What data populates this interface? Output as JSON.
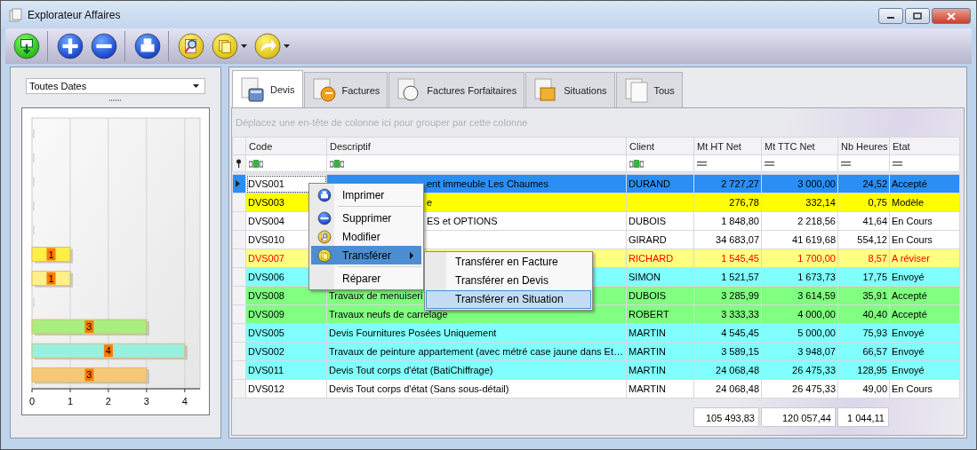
{
  "window": {
    "title": "Explorateur Affaires"
  },
  "toolbar": [
    {
      "kind": "export",
      "dropdown": false,
      "separator_after": true
    },
    {
      "kind": "add",
      "dropdown": false,
      "separator_after": false
    },
    {
      "kind": "remove",
      "dropdown": false,
      "separator_after": true
    },
    {
      "kind": "print",
      "dropdown": false,
      "separator_after": true
    },
    {
      "kind": "search",
      "dropdown": false,
      "separator_after": false
    },
    {
      "kind": "documents",
      "dropdown": true,
      "separator_after": false
    },
    {
      "kind": "forward",
      "dropdown": true,
      "separator_after": false
    }
  ],
  "date_filter": {
    "value": "Toutes Dates"
  },
  "chart_data": {
    "type": "bar",
    "orientation": "horizontal",
    "values": [
      0,
      0,
      0,
      0,
      0,
      1,
      1,
      0,
      3,
      4,
      3
    ],
    "colors": [
      "#dddddd",
      "#dddddd",
      "#dddddd",
      "#dddddd",
      "#dddddd",
      "#ffee44",
      "#fff08a",
      "#dddddd",
      "#a8ee80",
      "#9af0e0",
      "#f5c878"
    ],
    "xlim": [
      0,
      4.4
    ],
    "xticks": [
      0,
      1,
      2,
      3,
      4
    ],
    "grid": true,
    "value_labels": [
      null,
      null,
      null,
      null,
      null,
      "1",
      "1",
      null,
      "3",
      "4",
      "3"
    ]
  },
  "tabs": [
    {
      "label": "Devis",
      "kind": "calculator",
      "selected": true
    },
    {
      "label": "Factures",
      "kind": "euro",
      "selected": false
    },
    {
      "label": "Factures Forfaitaires",
      "kind": "euro-doc",
      "selected": false
    },
    {
      "label": "Situations",
      "kind": "percent",
      "selected": false
    },
    {
      "label": "Tous",
      "kind": "docs",
      "selected": false
    }
  ],
  "group_panel": {
    "placeholder": "Déplacez une en-tête de colonne ici pour grouper par cette colonne"
  },
  "table": {
    "columns": [
      {
        "label": "Code",
        "kind": "text"
      },
      {
        "label": "Descriptif",
        "kind": "text"
      },
      {
        "label": "Client",
        "kind": "text"
      },
      {
        "label": "Mt HT Net",
        "kind": "number"
      },
      {
        "label": "Mt TTC Net",
        "kind": "number"
      },
      {
        "label": "Nb Heures",
        "kind": "number"
      },
      {
        "label": "Etat",
        "kind": "number"
      }
    ],
    "rows": [
      {
        "selected": true,
        "under_menu": true,
        "alert": false,
        "code": "DVS001",
        "descriptif": "ent immeuble Les Chaumes",
        "client": "DURAND",
        "ht": "2 727,27",
        "ttc": "3 000,00",
        "heures": "24,52",
        "etat": "Accepté"
      },
      {
        "selected": false,
        "under_menu": true,
        "alert": false,
        "color": "#ffff00",
        "code": "DVS003",
        "descriptif": "e",
        "ht": "276,78",
        "ttc": "332,14",
        "heures": "0,75",
        "etat": "Modèle"
      },
      {
        "selected": false,
        "under_menu": true,
        "alert": false,
        "color": "#ffffff",
        "code": "DVS004",
        "descriptif": "ES et OPTIONS",
        "client": "DUBOIS",
        "ht": "1 848,80",
        "ttc": "2 218,56",
        "heures": "41,64",
        "etat": "En Cours"
      },
      {
        "selected": false,
        "alert": false,
        "color": "#ffffff",
        "code": "DVS010",
        "client": "GIRARD",
        "ht": "34 683,07",
        "ttc": "41 619,68",
        "heures": "554,12",
        "etat": "En Cours"
      },
      {
        "selected": false,
        "alert": true,
        "color": "#ffff80",
        "code": "DVS007",
        "client": "RICHARD",
        "ht": "1 545,45",
        "ttc": "1 700,00",
        "heures": "8,57",
        "etat": "A réviser"
      },
      {
        "selected": false,
        "alert": false,
        "color": "#80ffff",
        "code": "DVS006",
        "client": "SIMON",
        "ht": "1 521,57",
        "ttc": "1 673,73",
        "heures": "17,75",
        "etat": "Envoyé"
      },
      {
        "selected": false,
        "alert": false,
        "color": "#80ff80",
        "code": "DVS008",
        "descriptif": "Travaux de menuiseri",
        "client": "DUBOIS",
        "ht": "3 285,99",
        "ttc": "3 614,59",
        "heures": "35,91",
        "etat": "Accepté"
      },
      {
        "selected": false,
        "alert": false,
        "color": "#80ff80",
        "code": "DVS009",
        "descriptif": "Travaux neufs de carrelage",
        "client": "ROBERT",
        "ht": "3 333,33",
        "ttc": "4 000,00",
        "heures": "40,40",
        "etat": "Accepté"
      },
      {
        "selected": false,
        "alert": false,
        "color": "#80ffff",
        "code": "DVS005",
        "descriptif": "Devis Fournitures Posées Uniquement",
        "client": "MARTIN",
        "ht": "4 545,45",
        "ttc": "5 000,00",
        "heures": "75,93",
        "etat": "Envoyé"
      },
      {
        "selected": false,
        "alert": false,
        "color": "#80ffff",
        "code": "DVS002",
        "descriptif": "Travaux de peinture appartement (avec métré case jaune dans Et…",
        "client": "MARTIN",
        "ht": "3 589,15",
        "ttc": "3 948,07",
        "heures": "66,57",
        "etat": "Envoyé"
      },
      {
        "selected": false,
        "alert": false,
        "color": "#80ffff",
        "code": "DVS011",
        "descriptif": "Devis Tout corps d'état (BatiChiffrage)",
        "client": "MARTIN",
        "ht": "24 068,48",
        "ttc": "26 475,33",
        "heures": "128,95",
        "etat": "Envoyé"
      },
      {
        "selected": false,
        "alert": false,
        "color": "#ffffff",
        "code": "DVS012",
        "descriptif": "Devis Tout corps d'état (Sans sous-détail)",
        "client": "MARTIN",
        "ht": "24 068,48",
        "ttc": "26 475,33",
        "heures": "49,00",
        "etat": "En Cours"
      }
    ],
    "totals": {
      "ht": "105 493,83",
      "ttc": "120 057,44",
      "heures": "1 044,11"
    }
  },
  "context_menu": {
    "items": [
      {
        "label": "Imprimer",
        "kind": "print",
        "selected": false,
        "submenu": false,
        "separator_after": true
      },
      {
        "label": "Supprimer",
        "kind": "remove",
        "selected": false,
        "submenu": false,
        "separator_after": false
      },
      {
        "label": "Modifier",
        "kind": "search",
        "selected": false,
        "submenu": false,
        "separator_after": false
      },
      {
        "label": "Transférer",
        "kind": "documents",
        "selected": true,
        "submenu": true,
        "separator_after": true
      },
      {
        "label": "Réparer",
        "kind": "none",
        "selected": false,
        "submenu": false,
        "separator_after": false
      }
    ],
    "submenu": [
      {
        "label": "Transférer en Facture",
        "selected": false
      },
      {
        "label": "Transférer en Devis",
        "selected": false
      },
      {
        "label": "Transférer en Situation",
        "selected": true
      }
    ]
  }
}
